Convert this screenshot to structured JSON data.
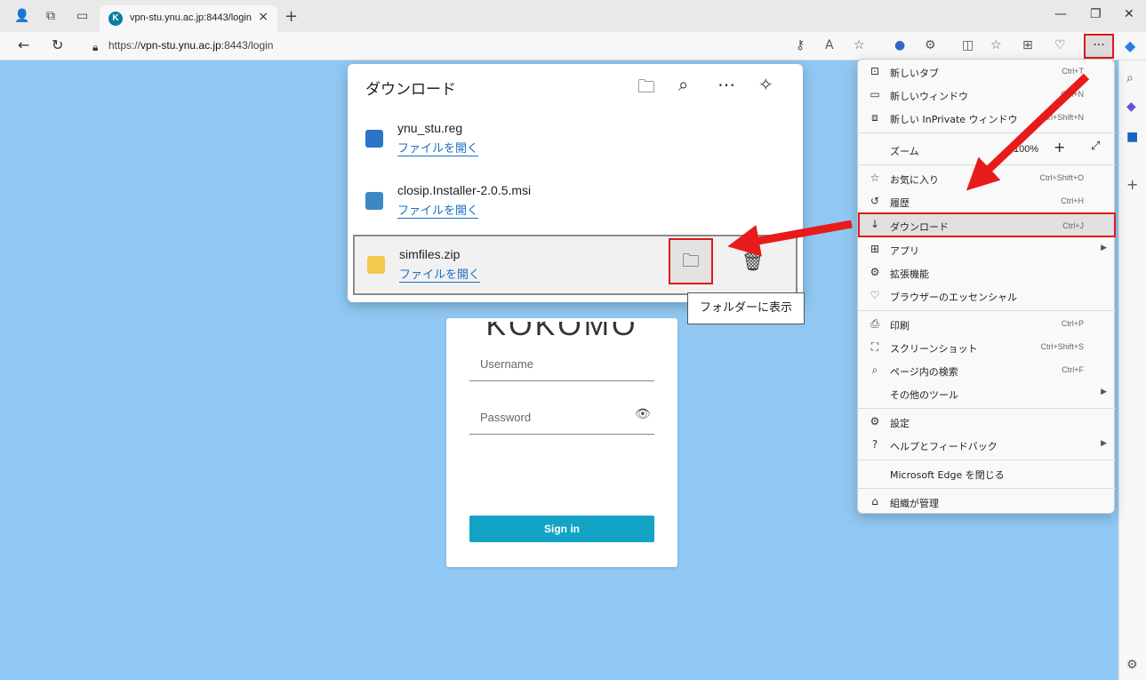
{
  "browser": {
    "tab_title": "vpn-stu.ynu.ac.jp:8443/login",
    "tab_favicon": "K",
    "new_tab": "+",
    "url_prefix": "https://",
    "url_host": "vpn-stu.ynu.ac.jp",
    "url_rest": ":8443/login",
    "more_label": "···"
  },
  "login": {
    "brand": "KOKOMO",
    "username_label": "Username",
    "password_label": "Password",
    "signin_label": "Sign in"
  },
  "downloads": {
    "title": "ダウンロード",
    "items": [
      {
        "name": "ynu_stu.reg",
        "open": "ファイルを開く"
      },
      {
        "name": "closip.Installer-2.0.5.msi",
        "open": "ファイルを開く"
      },
      {
        "name": "simfiles.zip",
        "open": "ファイルを開く"
      }
    ],
    "tooltip": "フォルダーに表示"
  },
  "menu": {
    "items": [
      {
        "label": "新しいタブ",
        "shortcut": "Ctrl+T",
        "icon": "new-tab-icon"
      },
      {
        "label": "新しいウィンドウ",
        "shortcut": "Ctrl+N",
        "icon": "new-window-icon"
      },
      {
        "label": "新しい InPrivate ウィンドウ",
        "shortcut": "Ctrl+Shift+N",
        "icon": "inprivate-icon"
      },
      {
        "label": "ズーム",
        "zoom": "100%",
        "icon": "zoom-icon"
      },
      {
        "label": "お気に入り",
        "shortcut": "Ctrl+Shift+O",
        "icon": "favorites-icon"
      },
      {
        "label": "履歴",
        "shortcut": "Ctrl+H",
        "icon": "history-icon"
      },
      {
        "label": "ダウンロード",
        "shortcut": "Ctrl+J",
        "icon": "download-icon"
      },
      {
        "label": "アプリ",
        "icon": "apps-icon"
      },
      {
        "label": "拡張機能",
        "icon": "extensions-icon"
      },
      {
        "label": "ブラウザーのエッセンシャル",
        "icon": "essentials-icon"
      },
      {
        "label": "印刷",
        "shortcut": "Ctrl+P",
        "icon": "print-icon"
      },
      {
        "label": "スクリーンショット",
        "shortcut": "Ctrl+Shift+S",
        "icon": "screenshot-icon"
      },
      {
        "label": "ページ内の検索",
        "shortcut": "Ctrl+F",
        "icon": "find-icon"
      },
      {
        "label": "その他のツール",
        "icon": "more-tools-icon"
      },
      {
        "label": "設定",
        "icon": "settings-icon"
      },
      {
        "label": "ヘルプとフィードバック",
        "icon": "help-icon"
      },
      {
        "label": "Microsoft Edge を閉じる",
        "icon": "close-edge-icon"
      },
      {
        "label": "組織が管理",
        "icon": "managed-icon"
      }
    ]
  },
  "colors": {
    "page_bg": "#90c8f3",
    "highlight": "#e01818",
    "signin": "#13a3c5",
    "link": "#1a6fc7"
  }
}
